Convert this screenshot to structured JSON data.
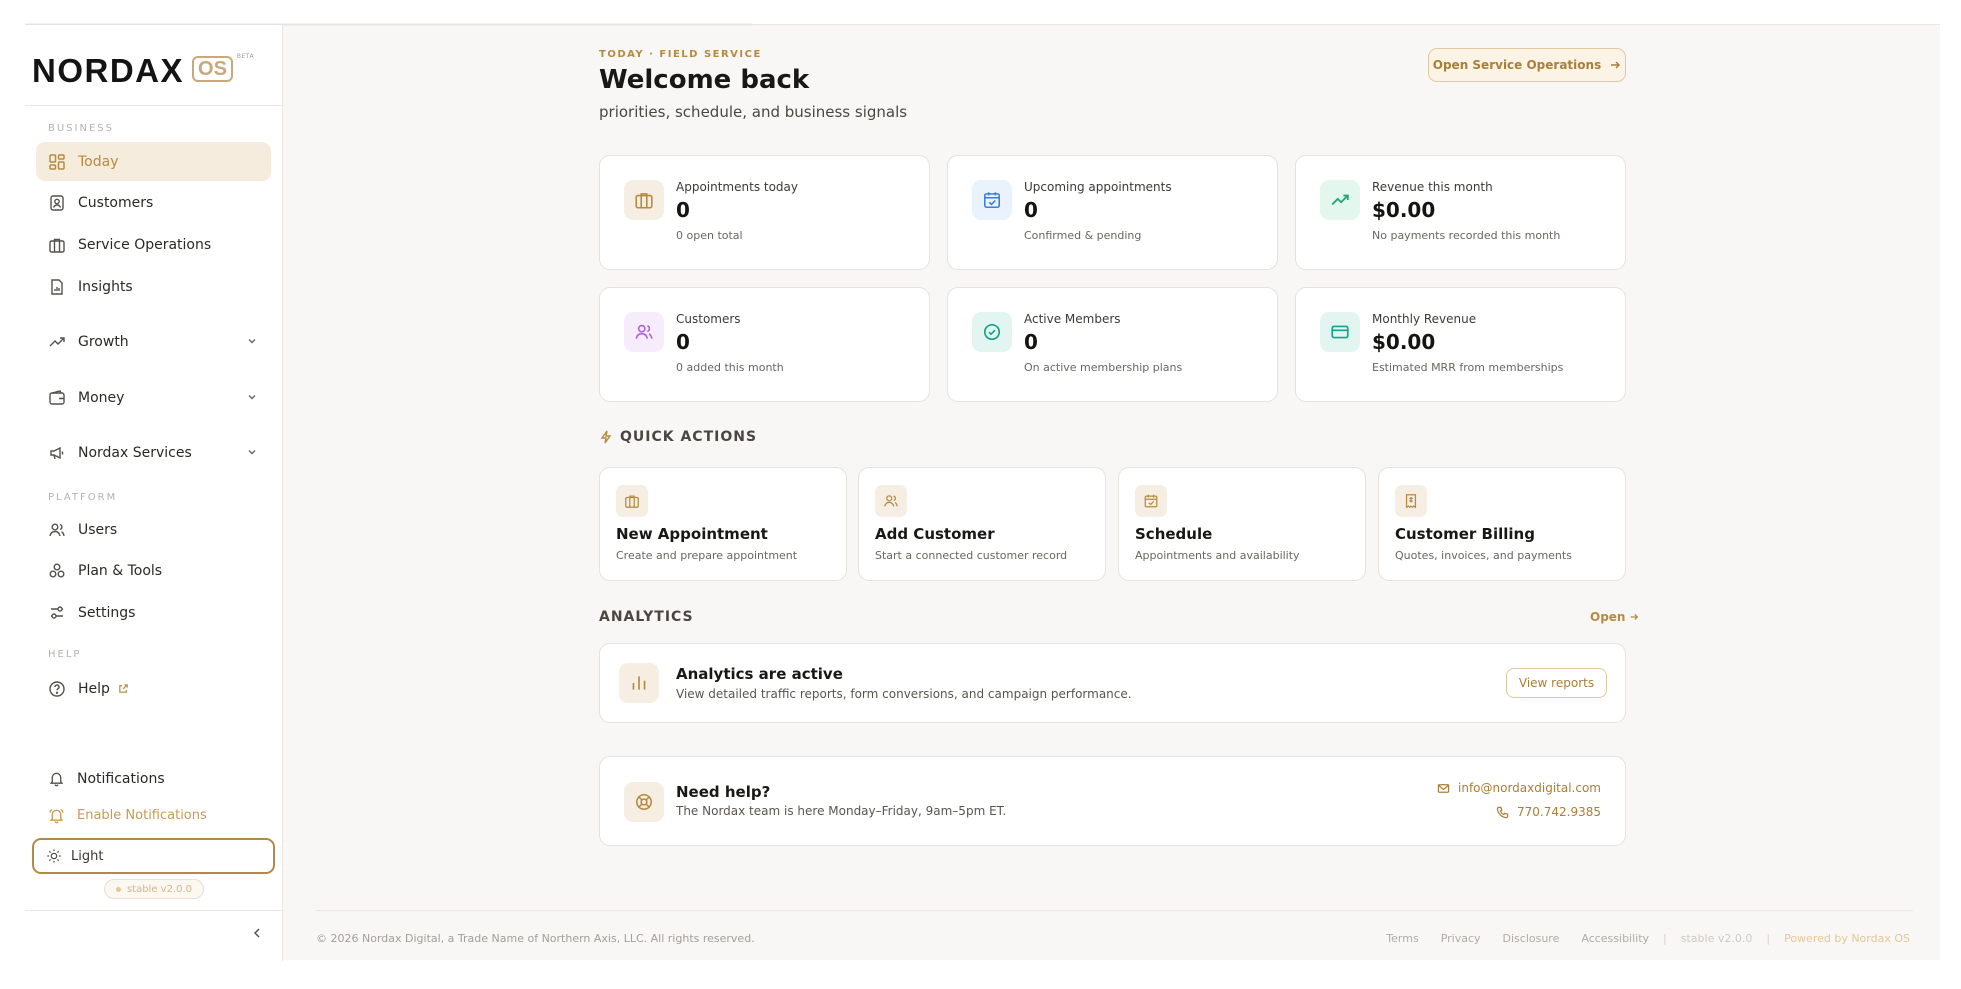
{
  "sidebar": {
    "brand": {
      "word": "NORDAX",
      "os": "OS",
      "beta": "BETA"
    },
    "sections": {
      "business": "BUSINESS",
      "platform": "PLATFORM",
      "help": "HELP"
    },
    "items": {
      "today": "Today",
      "customers": "Customers",
      "service_operations": "Service Operations",
      "insights": "Insights",
      "growth": "Growth",
      "money": "Money",
      "nordax_services": "Nordax Services",
      "users": "Users",
      "plan_tools": "Plan & Tools",
      "settings": "Settings",
      "help": "Help"
    },
    "notifications": "Notifications",
    "enable_notifications": "Enable Notifications",
    "theme": "Light",
    "version": "stable v2.0.0"
  },
  "header": {
    "eyebrow": "TODAY · FIELD SERVICE",
    "title": "Welcome back",
    "subtitle": "priorities, schedule, and business signals",
    "open_ops_label": "Open Service Operations"
  },
  "stats": [
    {
      "label": "Appointments today",
      "value": "0",
      "note": "0 open total"
    },
    {
      "label": "Upcoming appointments",
      "value": "0",
      "note": "Confirmed & pending"
    },
    {
      "label": "Revenue this month",
      "value": "$0.00",
      "note": "No payments recorded this month"
    },
    {
      "label": "Customers",
      "value": "0",
      "note": "0 added this month"
    },
    {
      "label": "Active Members",
      "value": "0",
      "note": "On active membership plans"
    },
    {
      "label": "Monthly Revenue",
      "value": "$0.00",
      "note": "Estimated MRR from memberships"
    }
  ],
  "quick_actions": {
    "heading": "QUICK ACTIONS",
    "items": [
      {
        "title": "New Appointment",
        "desc": "Create and prepare appointment"
      },
      {
        "title": "Add Customer",
        "desc": "Start a connected customer record"
      },
      {
        "title": "Schedule",
        "desc": "Appointments and availability"
      },
      {
        "title": "Customer Billing",
        "desc": "Quotes, invoices, and payments"
      }
    ]
  },
  "analytics": {
    "heading": "ANALYTICS",
    "open_label": "Open",
    "card_title": "Analytics are active",
    "card_desc": "View detailed traffic reports, form conversions, and campaign performance.",
    "button": "View reports"
  },
  "help_card": {
    "title": "Need help?",
    "desc": "The Nordax team is here Monday–Friday, 9am–5pm ET.",
    "email": "info@nordaxdigital.com",
    "phone": "770.742.9385"
  },
  "footer": {
    "copyright": "© 2026 Nordax Digital, a Trade Name of Northern Axis, LLC. All rights reserved.",
    "links": [
      "Terms",
      "Privacy",
      "Disclosure",
      "Accessibility"
    ],
    "separator": "|",
    "version": "stable v2.0.0",
    "powered": "Powered by Nordax OS"
  },
  "colors": {
    "accent": "#b58b3f",
    "accent_soft": "#f6ecdd",
    "blue_badge": "#eaf2fc",
    "green_badge": "#e4f7ef",
    "purple_badge": "#f6ecfb",
    "teal_badge": "#e3f5f1"
  }
}
